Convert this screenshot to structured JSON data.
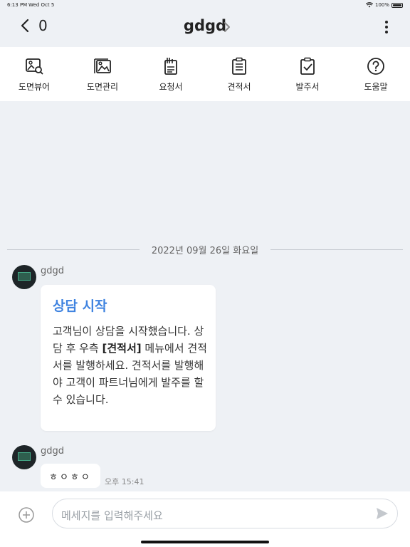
{
  "status": {
    "time": "6:13 PM",
    "date": "Wed Oct 5",
    "battery": "100%"
  },
  "nav": {
    "back_count": "0",
    "title": "gdgd"
  },
  "toolbar": [
    {
      "label": "도면뷰어",
      "icon": "drawing-viewer-icon"
    },
    {
      "label": "도면관리",
      "icon": "drawing-manage-icon"
    },
    {
      "label": "요청서",
      "icon": "request-icon"
    },
    {
      "label": "견적서",
      "icon": "estimate-icon"
    },
    {
      "label": "발주서",
      "icon": "order-icon"
    },
    {
      "label": "도움말",
      "icon": "help-icon"
    }
  ],
  "chat": {
    "date_divider": "2022년 09월 26일 화요일",
    "messages": [
      {
        "sender": "gdgd",
        "card_title": "상담 시작",
        "body_pre": "고객님이 상담을 시작했습니다. 상담 후 우측 ",
        "body_bold": "[견적서]",
        "body_post": " 메뉴에서 견적서를 발행하세요. 견적서를 발행해야 고객이 파트너님에게 발주를 할 수 있습니다."
      },
      {
        "sender": "gdgd",
        "text": "ㅎㅇㅎㅇ",
        "time": "오후 15:41"
      }
    ]
  },
  "input": {
    "placeholder": "메세지를 입력해주세요"
  },
  "colors": {
    "accent": "#3f83e0",
    "background": "#eef1f5"
  }
}
